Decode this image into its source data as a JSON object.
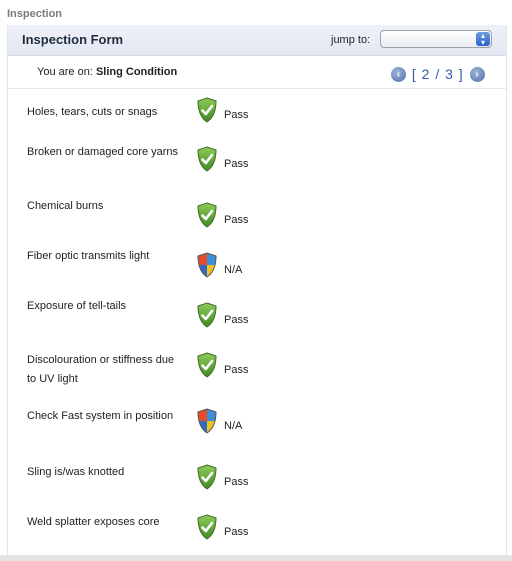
{
  "app": {
    "title": "Inspection"
  },
  "header": {
    "title": "Inspection Form",
    "jump_label": "jump to:",
    "jump_value": ""
  },
  "location": {
    "prefix": "You are on:",
    "section": "Sling Condition"
  },
  "pager": {
    "text": "[ 2 / 3 ]",
    "prev_icon": "arrow-left-circle-icon",
    "next_icon": "arrow-right-circle-icon"
  },
  "colors": {
    "pass_shield": "#6fae3f",
    "header_bg": "#e8ecf5",
    "accent": "#2f5ea8"
  },
  "items": [
    {
      "label": "Holes, tears, cuts or snags",
      "status": "Pass",
      "icon": "pass-shield-icon"
    },
    {
      "label": "Broken or damaged core yarns",
      "status": "Pass",
      "icon": "pass-shield-icon"
    },
    {
      "label": "Chemical burns",
      "status": "Pass",
      "icon": "pass-shield-icon"
    },
    {
      "label": "Fiber optic transmits light",
      "status": "N/A",
      "icon": "na-shield-icon"
    },
    {
      "label": "Exposure of tell-tails",
      "status": "Pass",
      "icon": "pass-shield-icon"
    },
    {
      "label": "Discolouration or stiffness due to UV light",
      "status": "Pass",
      "icon": "pass-shield-icon"
    },
    {
      "label": "Check Fast system in position",
      "status": "N/A",
      "icon": "na-shield-icon"
    },
    {
      "label": "Sling is/was knotted",
      "status": "Pass",
      "icon": "pass-shield-icon"
    },
    {
      "label": "Weld splatter exposes core",
      "status": "Pass",
      "icon": "pass-shield-icon"
    }
  ]
}
